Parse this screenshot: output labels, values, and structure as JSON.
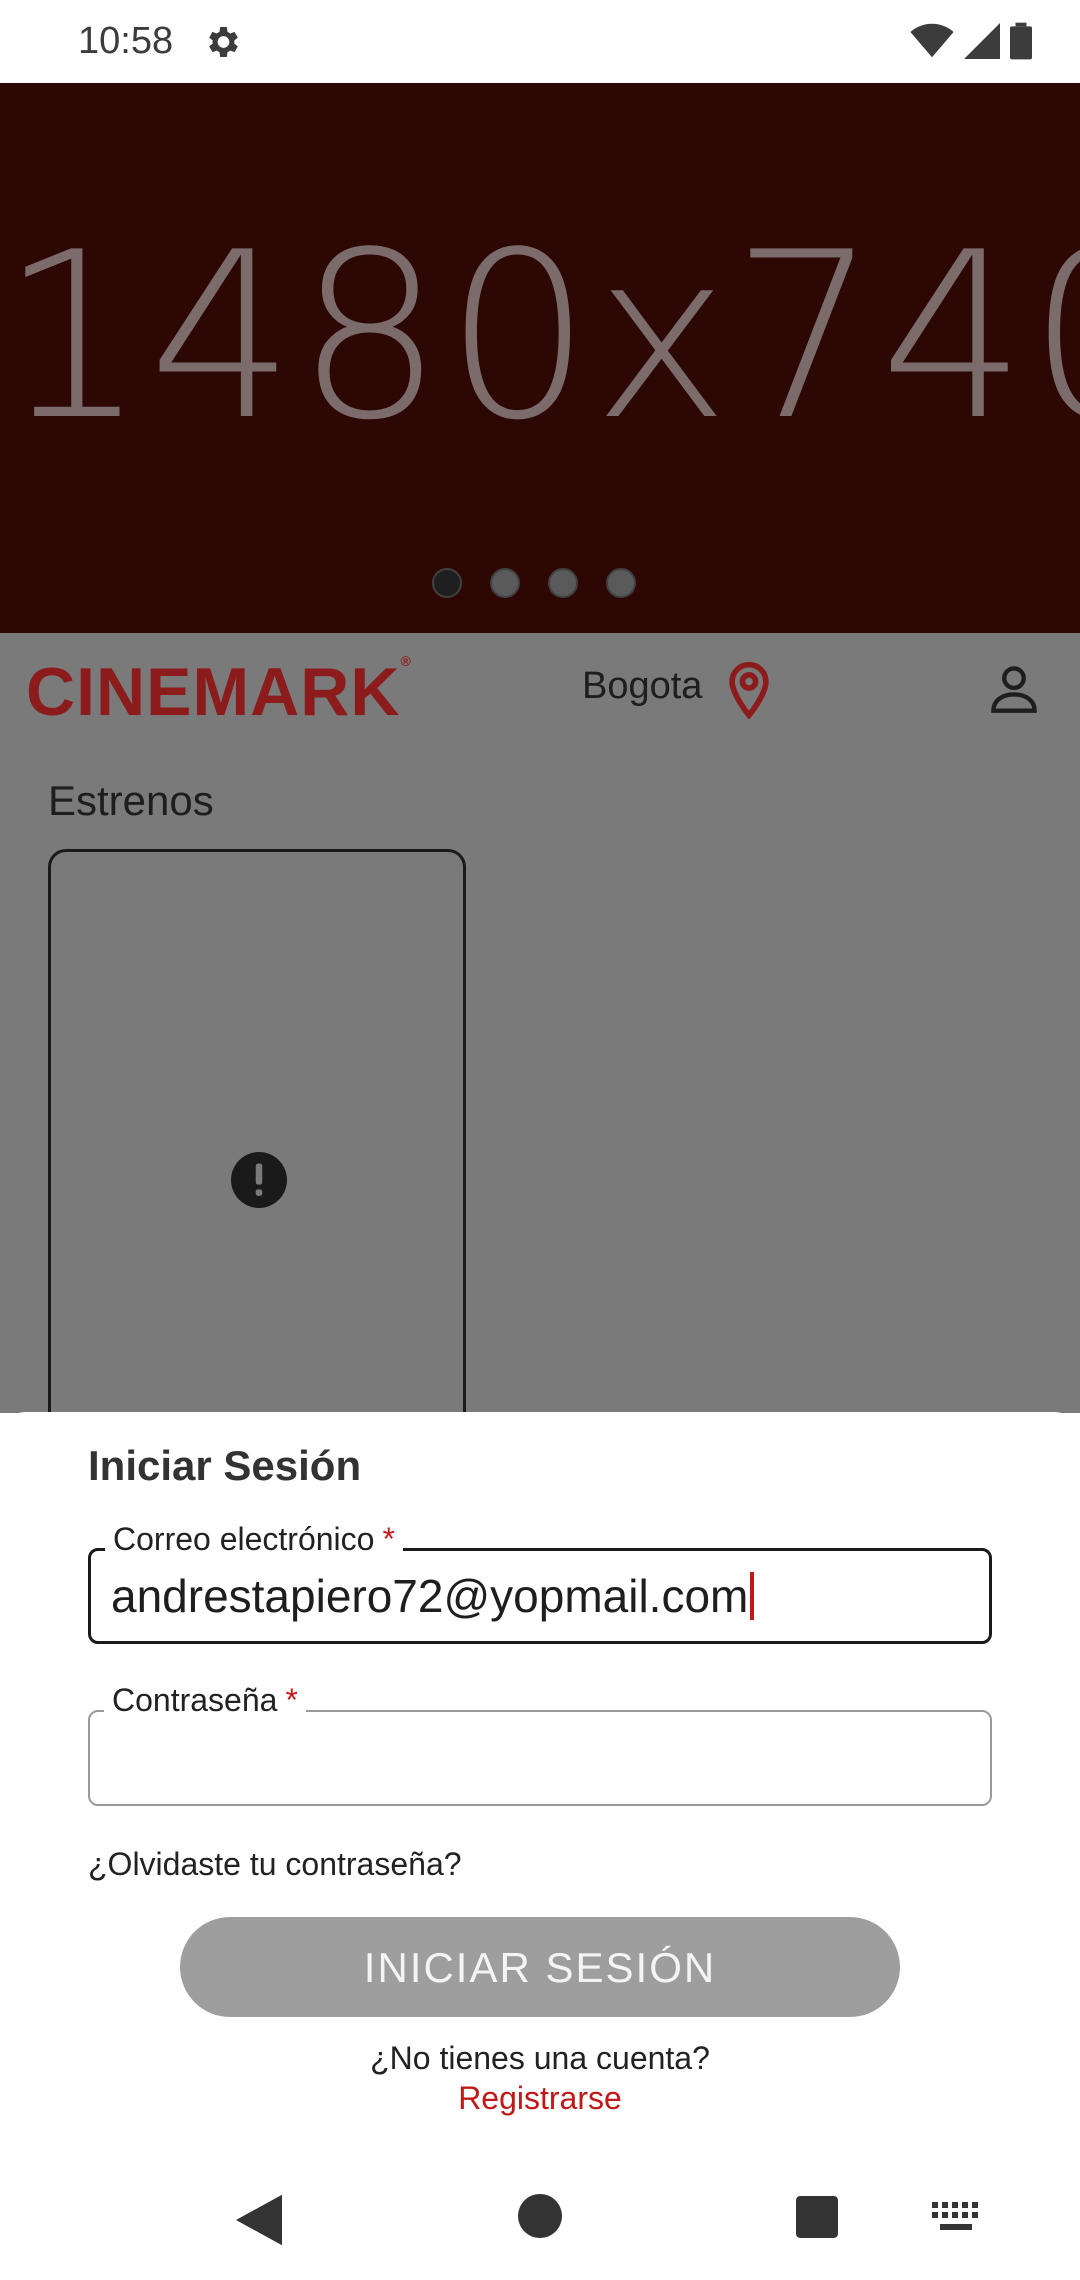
{
  "status_bar": {
    "time": "10:58"
  },
  "banner": {
    "placeholder_text": "1480x740",
    "slides_total": 4,
    "active_slide": 1
  },
  "app_bar": {
    "logo": "CINEMARK",
    "city": "Bogota"
  },
  "content": {
    "section_title": "Estrenos"
  },
  "login_sheet": {
    "title": "Iniciar Sesión",
    "email_label": "Correo electrónico",
    "email_value": "andrestapiero72@yopmail.com",
    "password_label": "Contraseña",
    "password_value": "",
    "required_mark": "*",
    "forgot_password": "¿Olvidaste tu contraseña?",
    "login_button": "INICIAR SESIÓN",
    "no_account_text": "¿No tienes una cuenta?",
    "register_link": "Registrarse"
  },
  "colors": {
    "brand_red": "#8c1b1b",
    "accent_red": "#c21818",
    "banner_bg": "#2d0704",
    "scrim_gray": "#7a7a7a",
    "disabled_button": "#9e9e9e"
  },
  "icons": [
    "gear-icon",
    "wifi-icon",
    "signal-icon",
    "battery-icon",
    "location-pin-icon",
    "user-icon",
    "warning-icon",
    "back-icon",
    "home-icon",
    "recents-icon",
    "keyboard-icon"
  ]
}
